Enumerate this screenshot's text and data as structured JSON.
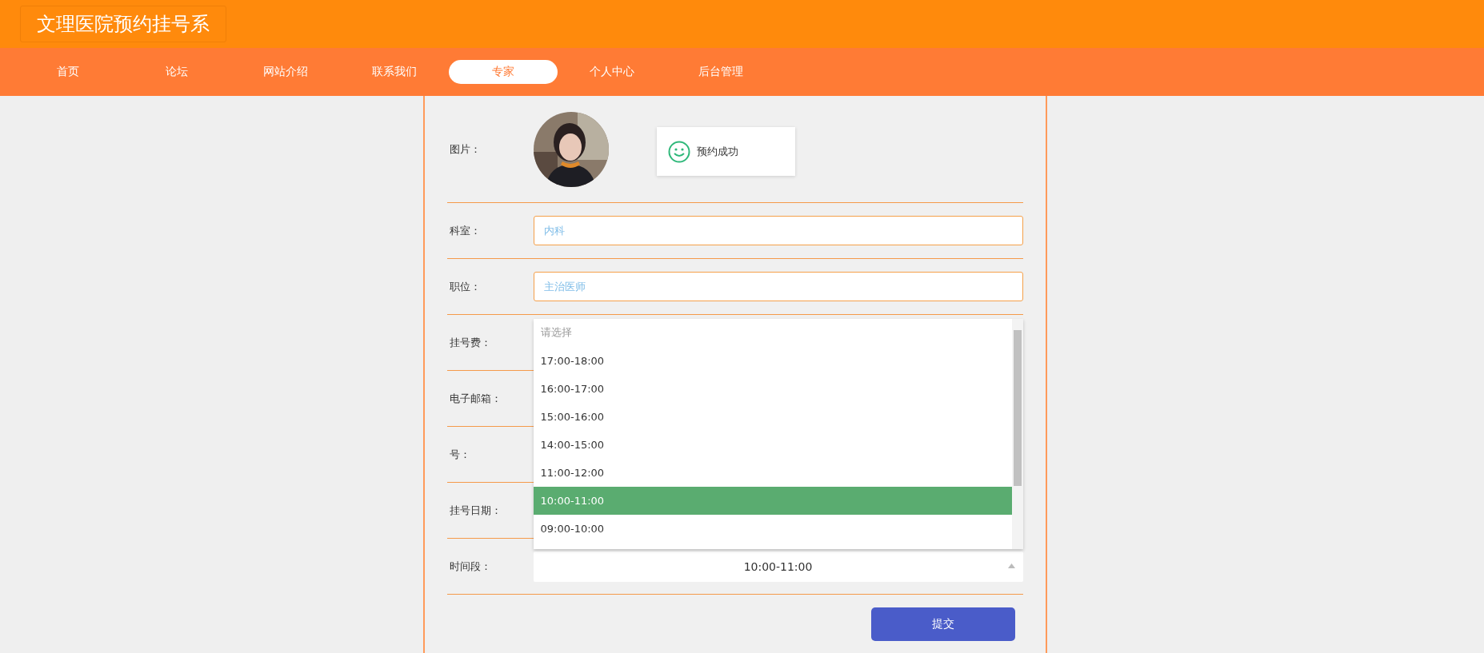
{
  "header": {
    "title": "文理医院预约挂号系"
  },
  "nav": [
    {
      "label": "首页",
      "selected": false
    },
    {
      "label": "论坛",
      "selected": false
    },
    {
      "label": "网站介绍",
      "selected": false
    },
    {
      "label": "联系我们",
      "selected": false
    },
    {
      "label": "专家",
      "selected": true
    },
    {
      "label": "个人中心",
      "selected": false
    },
    {
      "label": "后台管理",
      "selected": false
    }
  ],
  "form": {
    "image_label": "图片：",
    "toast": "预约成功",
    "fields": [
      {
        "label": "科室：",
        "kind": "text",
        "value": "内科"
      },
      {
        "label": "职位：",
        "kind": "text",
        "value": "主治医师"
      },
      {
        "label": "挂号费：",
        "kind": "covered"
      },
      {
        "label": "电子邮箱：",
        "kind": "covered"
      },
      {
        "label": "号：",
        "kind": "covered"
      },
      {
        "label": "挂号日期：",
        "kind": "covered"
      },
      {
        "label": "时间段：",
        "kind": "select",
        "value": "10:00-11:00",
        "expanded": true,
        "placeholder": "请选择",
        "options": [
          {
            "label": "17:00-18:00",
            "selected": false
          },
          {
            "label": "16:00-17:00",
            "selected": false
          },
          {
            "label": "15:00-16:00",
            "selected": false
          },
          {
            "label": "14:00-15:00",
            "selected": false
          },
          {
            "label": "11:00-12:00",
            "selected": false
          },
          {
            "label": "10:00-11:00",
            "selected": true
          },
          {
            "label": "09:00-10:00",
            "selected": false
          }
        ]
      }
    ],
    "submit": "提交"
  }
}
